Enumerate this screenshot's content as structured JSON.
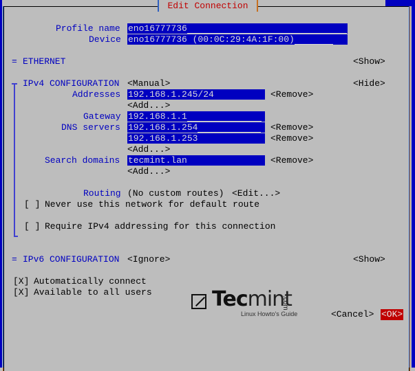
{
  "dialog": {
    "title": "Edit Connection"
  },
  "profile": {
    "profile_name_label": "Profile name",
    "profile_name_value": "eno16777736",
    "device_label": "Device",
    "device_value": "eno16777736 (00:0C:29:4A:1F:00)"
  },
  "ethernet": {
    "marker": "=",
    "label": "ETHERNET",
    "toggle": "<Show>"
  },
  "ipv4": {
    "marker": "=",
    "label": "IPv4 CONFIGURATION",
    "mode": "<Manual>",
    "toggle": "<Hide>",
    "addresses_label": "Addresses",
    "addresses": [
      "192.168.1.245/24"
    ],
    "gateway_label": "Gateway",
    "gateway": "192.168.1.1",
    "dns_label": "DNS servers",
    "dns": [
      "192.168.1.254",
      "192.168.1.253"
    ],
    "search_label": "Search domains",
    "search": [
      "tecmint.lan"
    ],
    "remove_label": "<Remove>",
    "add_label": "<Add...>",
    "routing_label": "Routing",
    "routing_value": "(No custom routes)",
    "routing_edit": "<Edit...>",
    "never_default_check": "[ ]",
    "never_default_label": "Never use this network for default route",
    "require_ipv4_check": "[ ]",
    "require_ipv4_label": "Require IPv4 addressing for this connection"
  },
  "ipv6": {
    "marker": "=",
    "label": "IPv6 CONFIGURATION",
    "mode": "<Ignore>",
    "toggle": "<Show>"
  },
  "options": {
    "auto_connect_check": "[X]",
    "auto_connect_label": "Automatically connect",
    "all_users_check": "[X]",
    "all_users_label": "Available to all users"
  },
  "buttons": {
    "cancel": "<Cancel>",
    "ok": "<OK>"
  },
  "watermark": {
    "brand_bold": "Tec",
    "brand_thin": "mint",
    "domain": ".com",
    "tagline": "Linux Howto's Guide"
  },
  "colors": {
    "background": "#bdbdbd",
    "field_bg": "#0000c0",
    "label": "#0000c0",
    "title": "#c00000",
    "ok_bg": "#c00000"
  }
}
